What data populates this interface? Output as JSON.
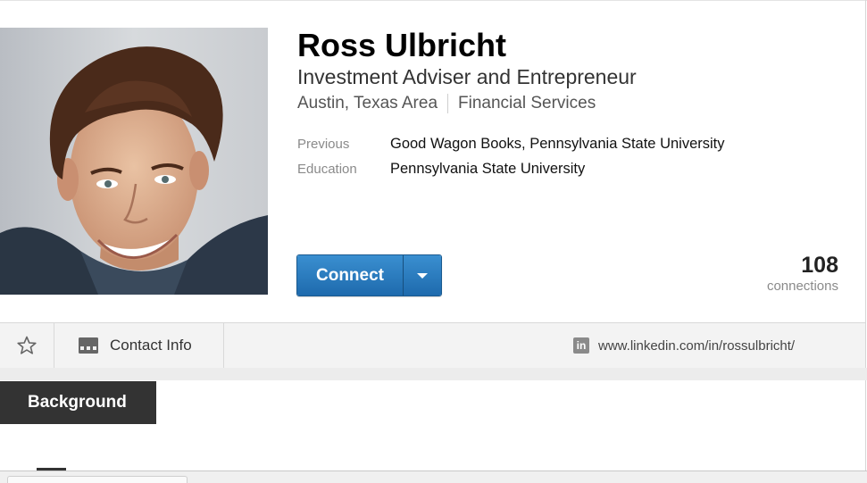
{
  "profile": {
    "name": "Ross Ulbricht",
    "headline": "Investment Adviser and Entrepreneur",
    "location": "Austin, Texas Area",
    "industry": "Financial Services"
  },
  "details": [
    {
      "label": "Previous",
      "value": "Good Wagon Books, Pennsylvania State University"
    },
    {
      "label": "Education",
      "value": "Pennsylvania State University"
    }
  ],
  "actions": {
    "connect_label": "Connect"
  },
  "connections": {
    "count": "108",
    "label": "connections"
  },
  "toolbar": {
    "contact_label": "Contact Info",
    "profile_url": "www.linkedin.com/in/rossulbricht/",
    "linkedin_badge": "in"
  },
  "sections": {
    "background_label": "Background"
  },
  "icons": {
    "star": "star-icon",
    "contact": "contact-card-icon",
    "linkedin": "linkedin-icon",
    "caret": "chevron-down-icon"
  },
  "colors": {
    "connect_button": "#2a7ac0",
    "background_tab": "#333333",
    "toolbar_bg": "#f3f3f3"
  }
}
